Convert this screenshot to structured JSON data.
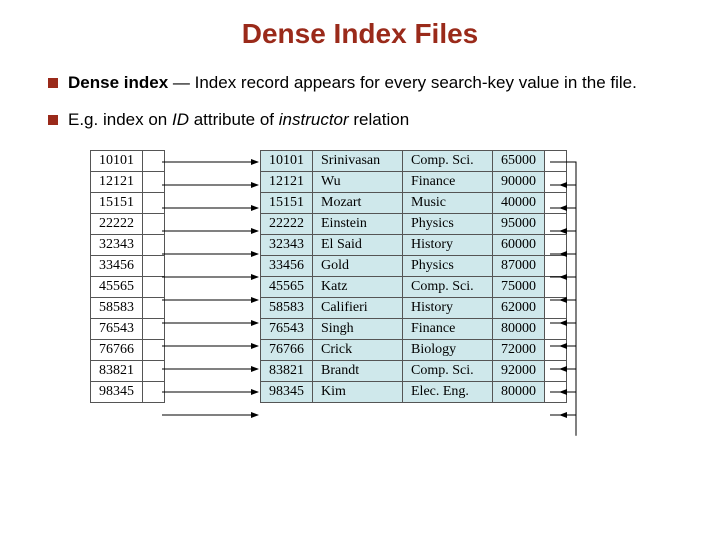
{
  "title": "Dense Index Files",
  "bullets": [
    {
      "bold": "Dense index",
      "rest": " — Index record appears for every search-key value in the file."
    },
    {
      "prefix": "E.g. index on ",
      "em1": "ID",
      "mid": " attribute of ",
      "em2": "instructor",
      "suffix": " relation"
    }
  ],
  "index_ids": [
    "10101",
    "12121",
    "15151",
    "22222",
    "32343",
    "33456",
    "45565",
    "58583",
    "76543",
    "76766",
    "83821",
    "98345"
  ],
  "records": [
    {
      "id": "10101",
      "name": "Srinivasan",
      "dept": "Comp. Sci.",
      "salary": "65000"
    },
    {
      "id": "12121",
      "name": "Wu",
      "dept": "Finance",
      "salary": "90000"
    },
    {
      "id": "15151",
      "name": "Mozart",
      "dept": "Music",
      "salary": "40000"
    },
    {
      "id": "22222",
      "name": "Einstein",
      "dept": "Physics",
      "salary": "95000"
    },
    {
      "id": "32343",
      "name": "El Said",
      "dept": "History",
      "salary": "60000"
    },
    {
      "id": "33456",
      "name": "Gold",
      "dept": "Physics",
      "salary": "87000"
    },
    {
      "id": "45565",
      "name": "Katz",
      "dept": "Comp. Sci.",
      "salary": "75000"
    },
    {
      "id": "58583",
      "name": "Califieri",
      "dept": "History",
      "salary": "62000"
    },
    {
      "id": "76543",
      "name": "Singh",
      "dept": "Finance",
      "salary": "80000"
    },
    {
      "id": "76766",
      "name": "Crick",
      "dept": "Biology",
      "salary": "72000"
    },
    {
      "id": "83821",
      "name": "Brandt",
      "dept": "Comp. Sci.",
      "salary": "92000"
    },
    {
      "id": "98345",
      "name": "Kim",
      "dept": "Elec. Eng.",
      "salary": "80000"
    }
  ]
}
